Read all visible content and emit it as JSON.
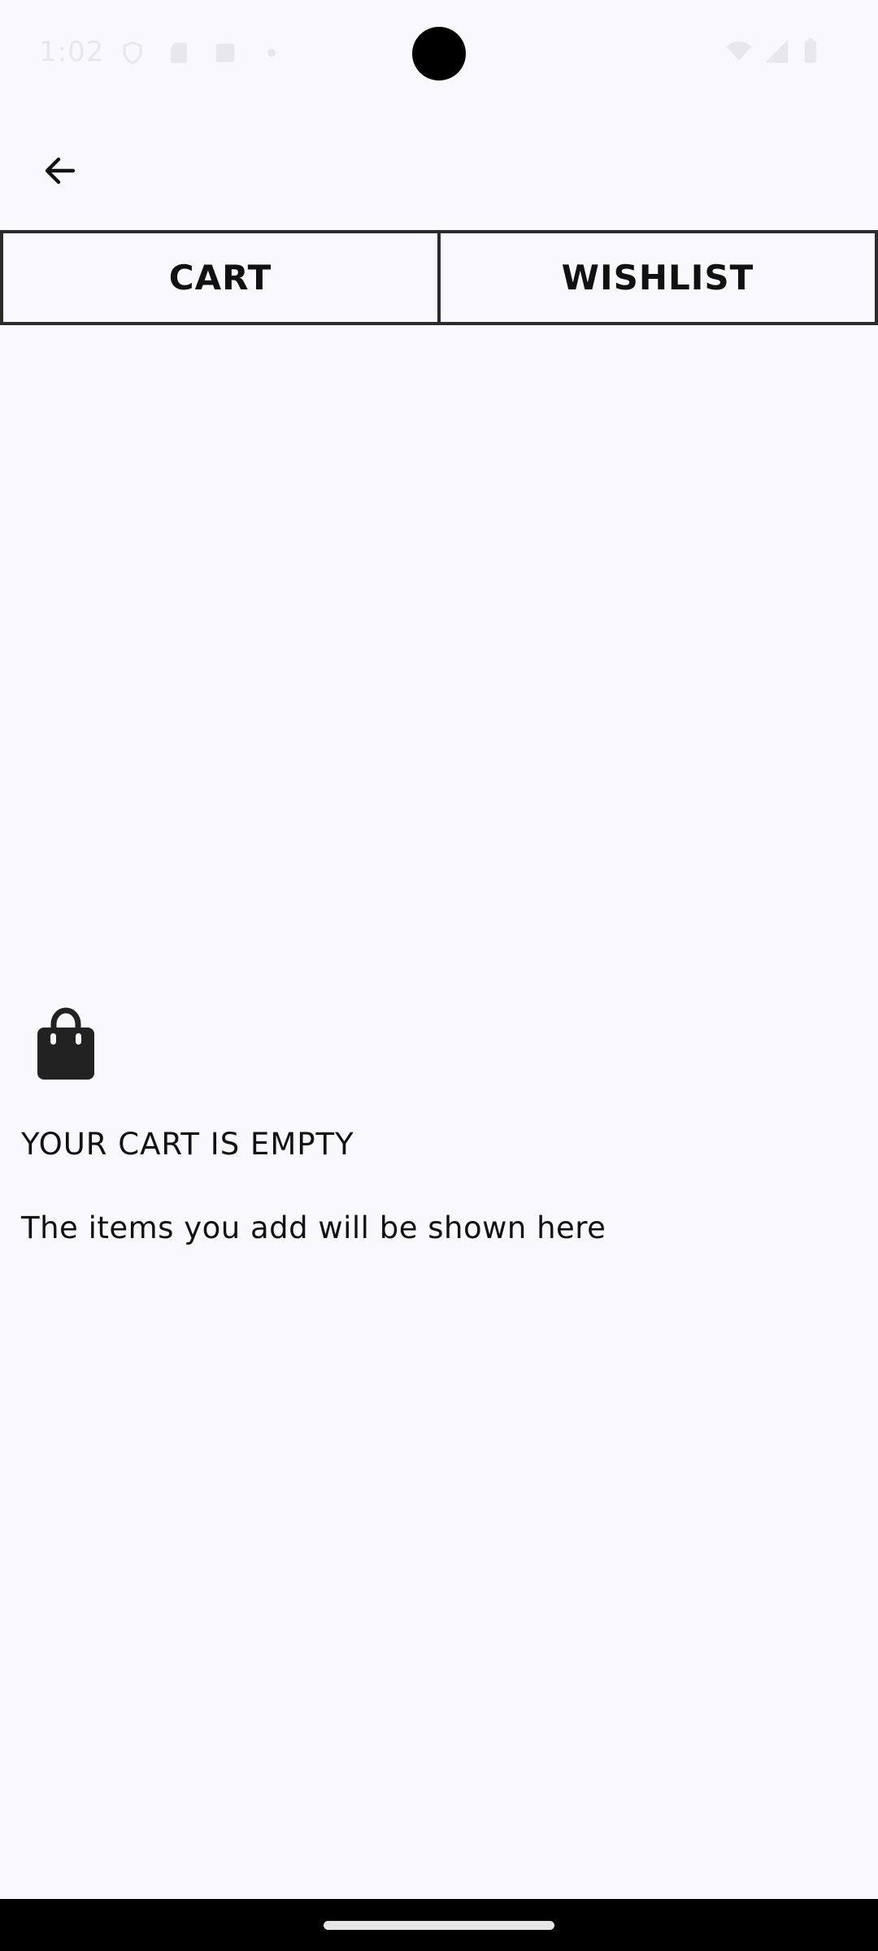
{
  "status_bar": {
    "time": "1:02"
  },
  "toolbar": {
    "back_icon": "arrow-back-icon"
  },
  "tabs": [
    {
      "label": "CART"
    },
    {
      "label": "WISHLIST"
    }
  ],
  "empty_state": {
    "icon": "shopping-bag-icon",
    "title": "YOUR CART IS EMPTY",
    "subtitle": "The items you add will be shown here"
  },
  "colors": {
    "background": "#f9f8fe",
    "text": "#111111",
    "tab_border": "#2b2b2b"
  }
}
